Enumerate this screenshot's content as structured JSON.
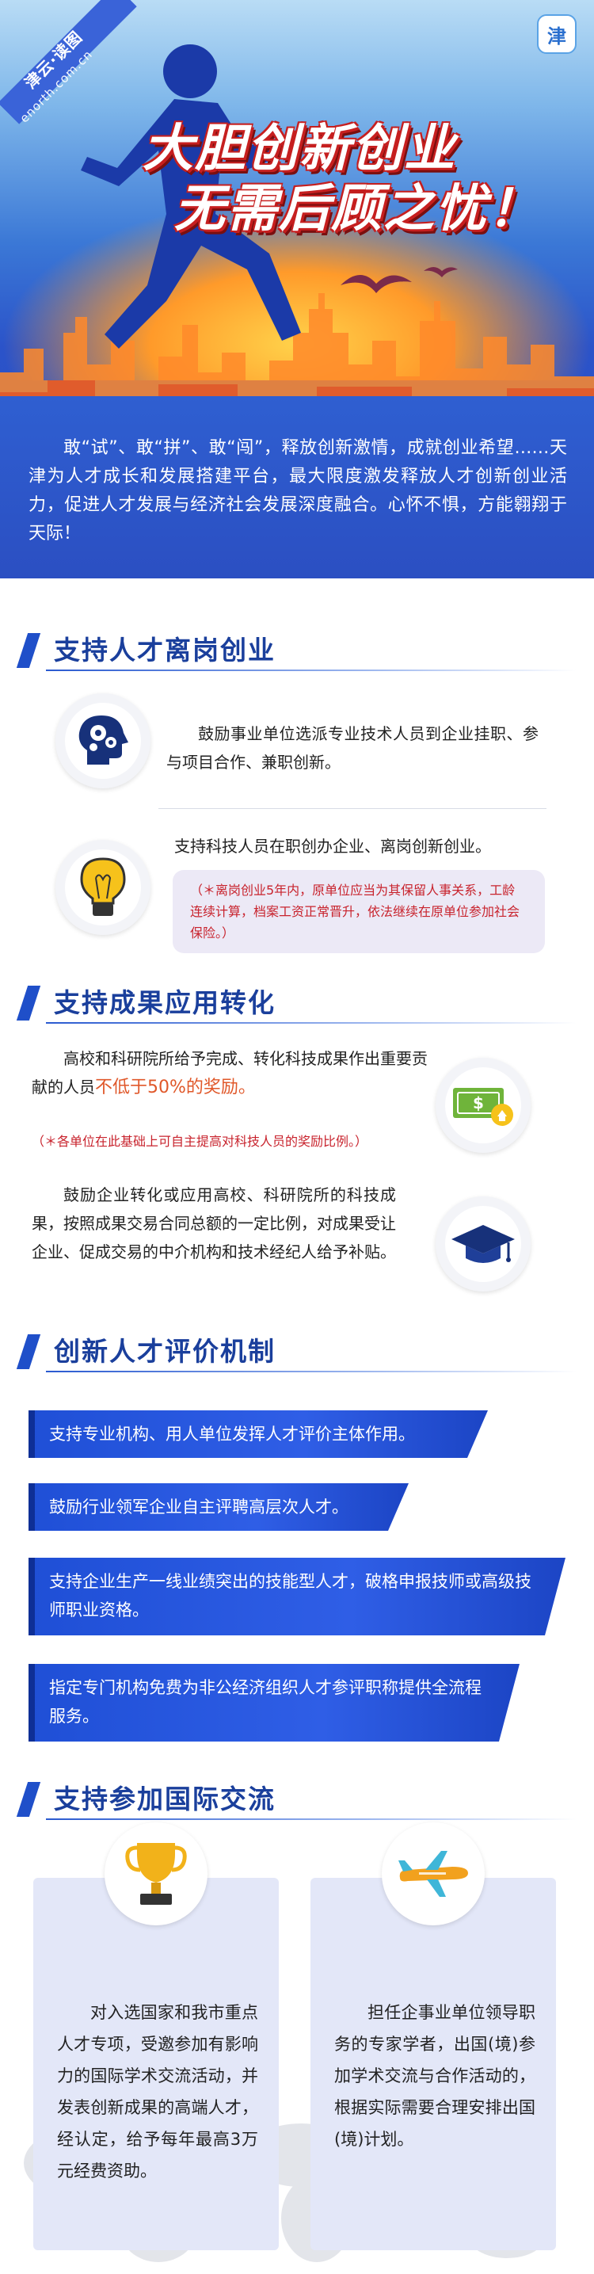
{
  "hero": {
    "brand_name": "津云·读图",
    "brand_url": "enorth.com.cn",
    "corner_logo": "津",
    "title_line1": "大胆创新创业",
    "title_line2": "无需后顾之忧！",
    "intro": "敢“试”、敢“拼”、敢“闯”，释放创新激情，成就创业希望……天津为人才成长和发展搭建平台，最大限度激发释放人才创新创业活力，促进人才发展与经济社会发展深度融合。心怀不惧，方能翱翔于天际！"
  },
  "section1": {
    "title": "支持人才离岗创业",
    "item1": "鼓励事业单位选派专业技术人员到企业挂职、参与项目合作、兼职创新。",
    "item2": "支持科技人员在职创办企业、离岗创新创业。",
    "item2_note": "（＊离岗创业5年内，原单位应当为其保留人事关系，工龄连续计算，档案工资正常晋升，依法继续在原单位参加社会保险。）"
  },
  "section2": {
    "title": "支持成果应用转化",
    "item1_a": "高校和科研院所给予完成、转化科技成果作出重要贡献的人员",
    "item1_hl": "不低于50%的奖励。",
    "item1_note": "（＊各单位在此基础上可自主提高对科技人员的奖励比例。）",
    "item2": "鼓励企业转化或应用高校、科研院所的科技成果，按照成果交易合同总额的一定比例，对成果受让企业、促成交易的中介机构和技术经纪人给予补贴。"
  },
  "section3": {
    "title": "创新人才评价机制",
    "banners": [
      "支持专业机构、用人单位发挥人才评价主体作用。",
      "鼓励行业领军企业自主评聘高层次人才。",
      "支持企业生产一线业绩突出的技能型人才，破格申报技师或高级技师职业资格。",
      "指定专门机构免费为非公经济组织人才参评职称提供全流程服务。"
    ]
  },
  "section4": {
    "title": "支持参加国际交流",
    "card1": "对入选国家和我市重点人才专项，受邀参加有影响力的国际学术交流活动，并发表创新成果的高端人才，经认定，给予每年最高3万元经费资助。",
    "card2": "担任企事业单位领导职务的专家学者，出国(境)参加学术交流与合作活动的，根据实际需要合理安排出国(境)计划。"
  },
  "icons": [
    "head-gears-icon",
    "lightbulb-icon",
    "money-icon",
    "graduation-cap-icon",
    "trophy-icon",
    "airplane-icon"
  ],
  "colors": {
    "primary_blue": "#1f4fc9",
    "title_red": "#c61f1f",
    "note_red": "#c8232d",
    "highlight_orange": "#e0582a"
  }
}
